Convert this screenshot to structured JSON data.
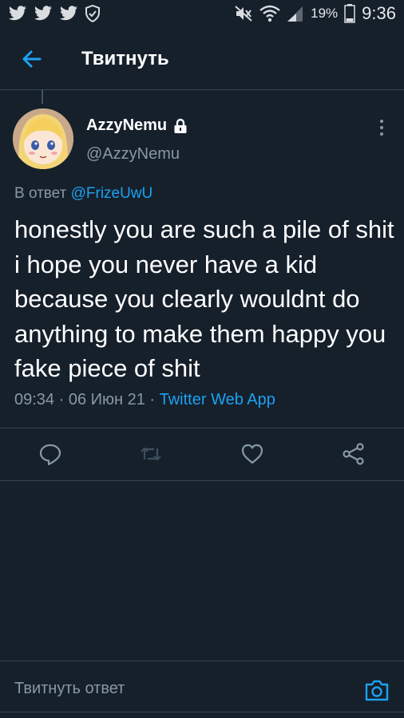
{
  "status_bar": {
    "battery_percent": "19%",
    "time": "9:36",
    "icons": [
      "twitter-notification-icon",
      "twitter-notification-icon",
      "twitter-notification-icon",
      "shield-check-icon",
      "mute-icon",
      "wifi-icon",
      "signal-icon",
      "battery-icon"
    ]
  },
  "header": {
    "title": "Твитнуть"
  },
  "tweet": {
    "display_name": "AzzyNemu",
    "handle": "@AzzyNemu",
    "reply_prefix": "В ответ ",
    "reply_mention": "@FrizeUwU",
    "text": "honestly you are such a pile of shit i hope you never have a kid because you clearly wouldnt do anything to make them happy you fake piece of shit",
    "timestamp": "09:34 · 06 Июн 21 · ",
    "source": "Twitter Web App"
  },
  "reply_bar": {
    "placeholder": "Твитнуть ответ"
  },
  "colors": {
    "background": "#15202b",
    "accent": "#1da1f2",
    "secondary_text": "#8899a6",
    "divider": "#38444d"
  }
}
